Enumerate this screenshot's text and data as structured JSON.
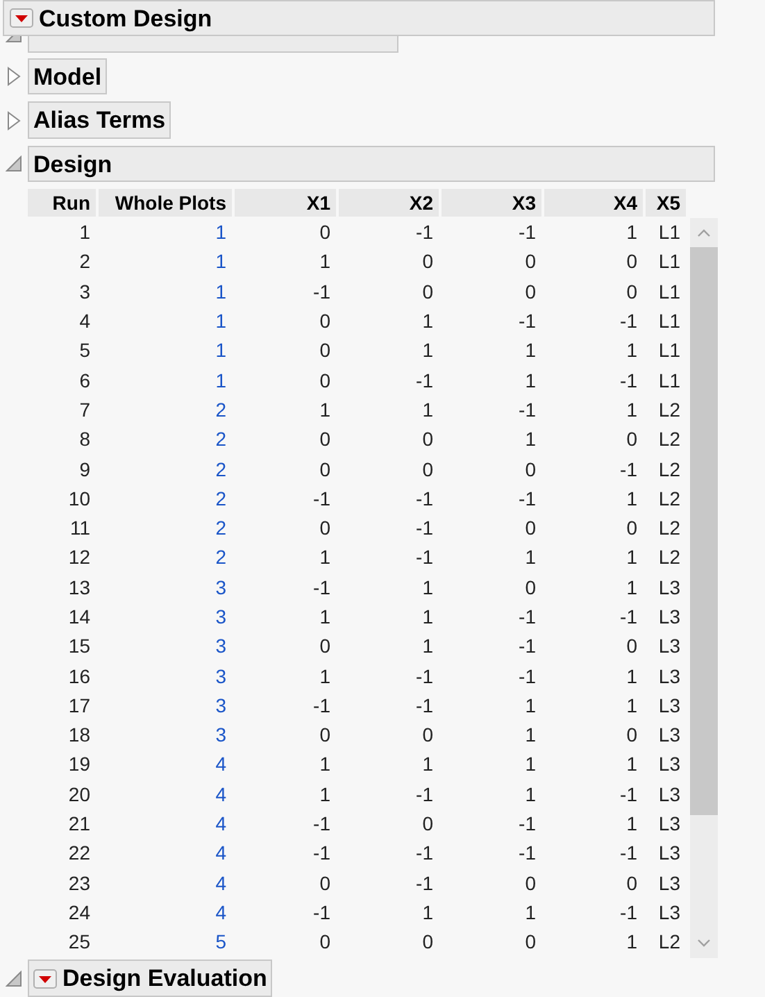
{
  "window": {
    "title": "Custom Design",
    "menu": true
  },
  "sections": [
    {
      "expanded": true,
      "menu": false
    },
    {
      "title": "Model",
      "expanded": false,
      "menu": false
    },
    {
      "title": "Alias Terms",
      "expanded": false,
      "menu": false
    },
    {
      "title": "Design",
      "expanded": true,
      "menu": false
    }
  ],
  "table": {
    "columns": [
      "Run",
      "Whole Plots",
      "X1",
      "X2",
      "X3",
      "X4",
      "X5"
    ],
    "rows": [
      [
        "1",
        "1",
        "0",
        "-1",
        "-1",
        "1",
        "L1"
      ],
      [
        "2",
        "1",
        "1",
        "0",
        "0",
        "0",
        "L1"
      ],
      [
        "3",
        "1",
        "-1",
        "0",
        "0",
        "0",
        "L1"
      ],
      [
        "4",
        "1",
        "0",
        "1",
        "-1",
        "-1",
        "L1"
      ],
      [
        "5",
        "1",
        "0",
        "1",
        "1",
        "1",
        "L1"
      ],
      [
        "6",
        "1",
        "0",
        "-1",
        "1",
        "-1",
        "L1"
      ],
      [
        "7",
        "2",
        "1",
        "1",
        "-1",
        "1",
        "L2"
      ],
      [
        "8",
        "2",
        "0",
        "0",
        "1",
        "0",
        "L2"
      ],
      [
        "9",
        "2",
        "0",
        "0",
        "0",
        "-1",
        "L2"
      ],
      [
        "10",
        "2",
        "-1",
        "-1",
        "-1",
        "1",
        "L2"
      ],
      [
        "11",
        "2",
        "0",
        "-1",
        "0",
        "0",
        "L2"
      ],
      [
        "12",
        "2",
        "1",
        "-1",
        "1",
        "1",
        "L2"
      ],
      [
        "13",
        "3",
        "-1",
        "1",
        "0",
        "1",
        "L3"
      ],
      [
        "14",
        "3",
        "1",
        "1",
        "-1",
        "-1",
        "L3"
      ],
      [
        "15",
        "3",
        "0",
        "1",
        "-1",
        "0",
        "L3"
      ],
      [
        "16",
        "3",
        "1",
        "-1",
        "-1",
        "1",
        "L3"
      ],
      [
        "17",
        "3",
        "-1",
        "-1",
        "1",
        "1",
        "L3"
      ],
      [
        "18",
        "3",
        "0",
        "0",
        "1",
        "0",
        "L3"
      ],
      [
        "19",
        "4",
        "1",
        "1",
        "1",
        "1",
        "L3"
      ],
      [
        "20",
        "4",
        "1",
        "-1",
        "1",
        "-1",
        "L3"
      ],
      [
        "21",
        "4",
        "-1",
        "0",
        "-1",
        "1",
        "L3"
      ],
      [
        "22",
        "4",
        "-1",
        "-1",
        "-1",
        "-1",
        "L3"
      ],
      [
        "23",
        "4",
        "0",
        "-1",
        "0",
        "0",
        "L3"
      ],
      [
        "24",
        "4",
        "-1",
        "1",
        "1",
        "-1",
        "L3"
      ],
      [
        "25",
        "5",
        "0",
        "0",
        "0",
        "1",
        "L2"
      ]
    ]
  },
  "footer_section": {
    "title": "Design Evaluation",
    "expanded": true,
    "menu": true
  }
}
